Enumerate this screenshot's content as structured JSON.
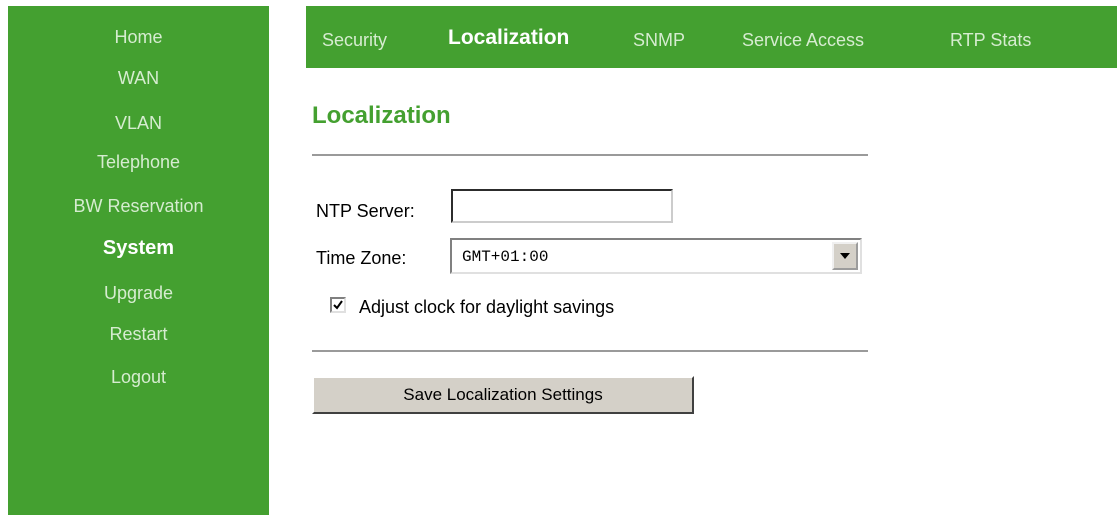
{
  "sidebar": {
    "items": [
      {
        "label": "Home",
        "active": false
      },
      {
        "label": "WAN",
        "active": false
      },
      {
        "label": "VLAN",
        "active": false
      },
      {
        "label": "Telephone",
        "active": false
      },
      {
        "label": "BW Reservation",
        "active": false
      },
      {
        "label": "System",
        "active": true
      },
      {
        "label": "Upgrade",
        "active": false
      },
      {
        "label": "Restart",
        "active": false
      },
      {
        "label": "Logout",
        "active": false
      }
    ]
  },
  "tabs": [
    {
      "label": "Security",
      "active": false
    },
    {
      "label": "Localization",
      "active": true
    },
    {
      "label": "SNMP",
      "active": false
    },
    {
      "label": "Service Access",
      "active": false
    },
    {
      "label": "RTP Stats",
      "active": false
    }
  ],
  "main": {
    "title": "Localization",
    "ntp_label": "NTP Server:",
    "ntp_value": "",
    "timezone_label": "Time Zone:",
    "timezone_value": "GMT+01:00",
    "daylight_label": "Adjust clock for daylight savings",
    "daylight_checked": true,
    "save_label": "Save Localization Settings"
  },
  "colors": {
    "accent": "#44a030",
    "inactive_text": "#d6ecd0",
    "active_text": "#ffffff"
  },
  "icons": {
    "select_arrow": "chevron-down-icon",
    "checkbox_mark": "checkmark-icon"
  }
}
